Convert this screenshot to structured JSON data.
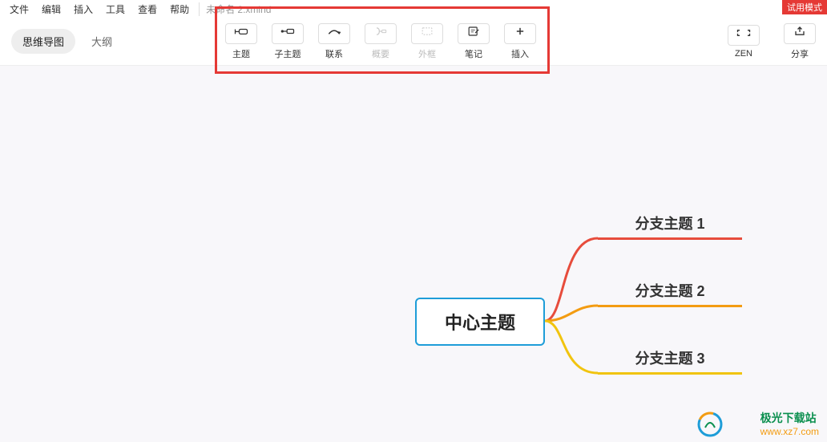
{
  "menubar": {
    "items": [
      "文件",
      "编辑",
      "插入",
      "工具",
      "查看",
      "帮助"
    ],
    "file_name": "未命名 2.xmind",
    "trial": "试用模式"
  },
  "tabs": {
    "mindmap": "思维导图",
    "outline": "大纲"
  },
  "toolbar": {
    "topic": "主题",
    "subtopic": "子主题",
    "relationship": "联系",
    "summary": "概要",
    "boundary": "外框",
    "notes": "笔记",
    "insert": "插入"
  },
  "right": {
    "zen": "ZEN",
    "share": "分享"
  },
  "mindmap": {
    "central": "中心主题",
    "branch1": "分支主题 1",
    "branch2": "分支主题 2",
    "branch3": "分支主题 3"
  },
  "watermark": {
    "name": "极光下载站",
    "url": "www.xz7.com"
  },
  "colors": {
    "accent": "#1e9dd8",
    "branch1": "#e74c3c",
    "branch2": "#f39c12",
    "branch3": "#f1c40f",
    "highlight": "#e53935"
  }
}
